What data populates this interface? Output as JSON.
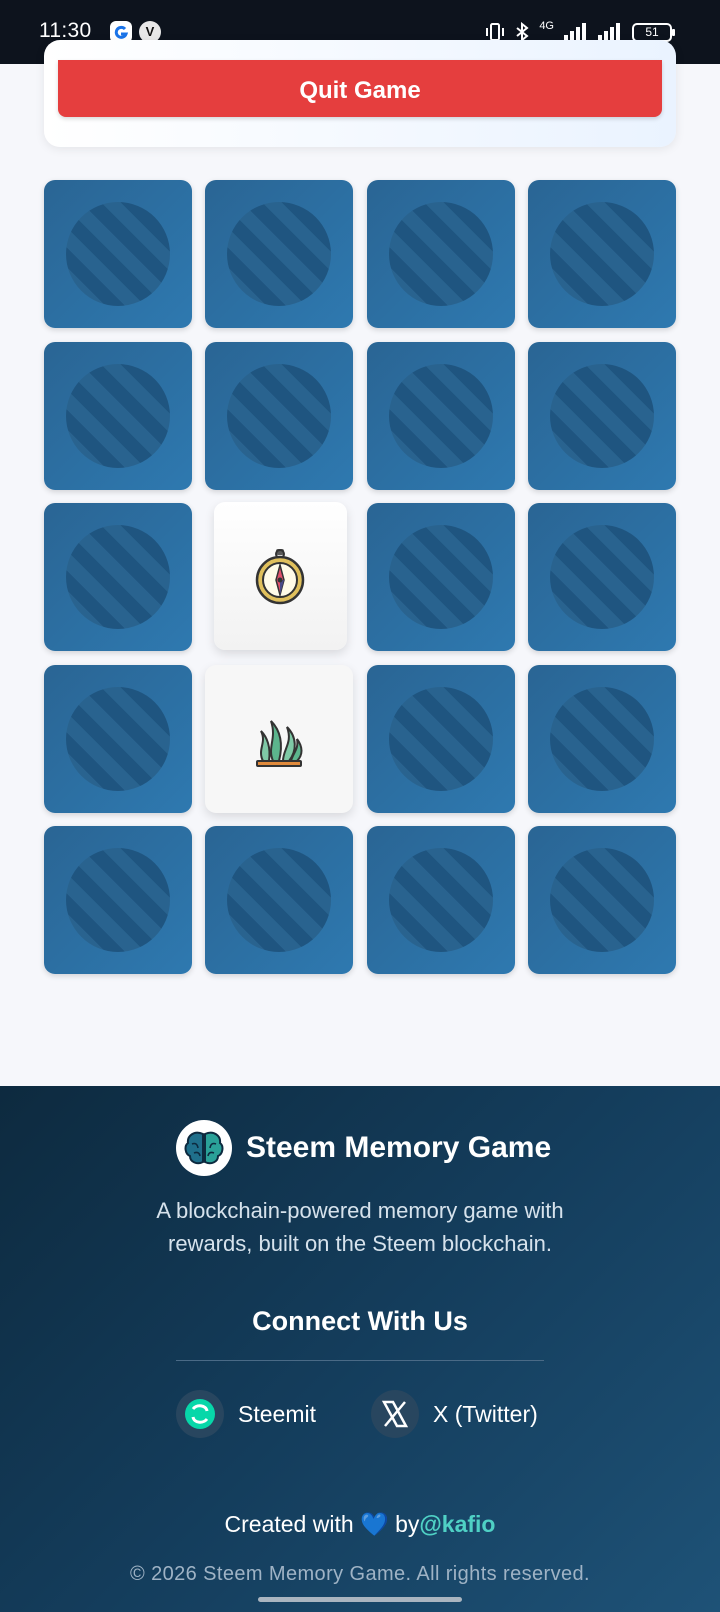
{
  "status_bar": {
    "time": "11:30",
    "network": "4G",
    "battery": "51"
  },
  "game": {
    "quit_label": "Quit Game",
    "grid": {
      "rows": 5,
      "columns": 4,
      "revealed": [
        {
          "row": 3,
          "column": 2,
          "icon": "compass-icon"
        },
        {
          "row": 4,
          "column": 2,
          "icon": "seaweed-icon"
        }
      ]
    }
  },
  "footer": {
    "brand_title": "Steem Memory Game",
    "tagline_line1": "A blockchain-powered memory game with",
    "tagline_line2": "rewards, built on the Steem blockchain.",
    "connect_title": "Connect With Us",
    "social": {
      "steemit": "Steemit",
      "x": "X (Twitter)"
    },
    "credits_prefix": "Created with",
    "credits_heart": "💙",
    "credits_by": "by",
    "credits_handle": "@kafio",
    "copyright": "© 2026 Steem Memory Game. All rights reserved."
  },
  "colors": {
    "quit": "#e53e3e",
    "card_back": "#2e79b0",
    "footer": "#143d5c",
    "accent": "#4fd1c5"
  }
}
